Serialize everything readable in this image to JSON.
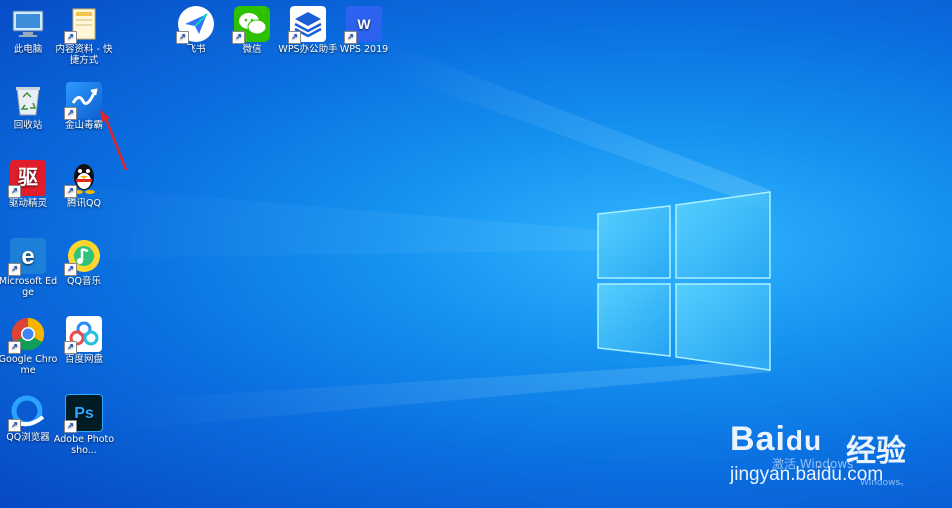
{
  "desktop": {
    "wallpaper": "windows-10-blue",
    "icons": [
      {
        "id": "this-pc",
        "label": "此电脑",
        "icon": "computer-icon",
        "shortcut": false
      },
      {
        "id": "content-shortcut",
        "label": "内容资料 - 快捷方式",
        "icon": "folder-icon",
        "shortcut": true
      },
      {
        "id": "feishu",
        "label": "飞书",
        "icon": "feishu-icon",
        "shortcut": true
      },
      {
        "id": "wechat",
        "label": "微信",
        "icon": "wechat-icon",
        "shortcut": true
      },
      {
        "id": "wps-office",
        "label": "WPS办公助手",
        "icon": "wps-assistant-icon",
        "shortcut": true
      },
      {
        "id": "wps-2019",
        "label": "WPS 2019",
        "icon": "wps-icon",
        "shortcut": true
      },
      {
        "id": "recycle-bin",
        "label": "回收站",
        "icon": "recycle-bin-icon",
        "shortcut": false
      },
      {
        "id": "kingsoft-antivirus",
        "label": "金山毒霸",
        "icon": "kingsoft-antivirus-icon",
        "shortcut": true
      },
      {
        "id": "driver-genius",
        "label": "驱动精灵",
        "icon": "driver-genius-icon",
        "shortcut": true
      },
      {
        "id": "tencent-qq",
        "label": "腾讯QQ",
        "icon": "qq-penguin-icon",
        "shortcut": true
      },
      {
        "id": "edge",
        "label": "Microsoft Edge",
        "icon": "edge-icon",
        "shortcut": true
      },
      {
        "id": "qq-music",
        "label": "QQ音乐",
        "icon": "qq-music-icon",
        "shortcut": true
      },
      {
        "id": "chrome",
        "label": "Google Chrome",
        "icon": "chrome-icon",
        "shortcut": true
      },
      {
        "id": "baidu-netdisk",
        "label": "百度网盘",
        "icon": "baidu-netdisk-icon",
        "shortcut": true
      },
      {
        "id": "qq-browser",
        "label": "QQ浏览器",
        "icon": "qq-browser-icon",
        "shortcut": true
      },
      {
        "id": "photoshop",
        "label": "Adobe Photosho...",
        "icon": "photoshop-icon",
        "shortcut": true
      }
    ]
  },
  "watermark": {
    "logo": "Bai",
    "logo_paw": "du",
    "jing": "经验",
    "url": "jingyan.baidu.com"
  },
  "activation": {
    "line1": "激活 Windows",
    "line2": "Windows。"
  },
  "colors": {
    "annotation_arrow": "#e0252b",
    "win_logo": "#7fe4ff"
  }
}
